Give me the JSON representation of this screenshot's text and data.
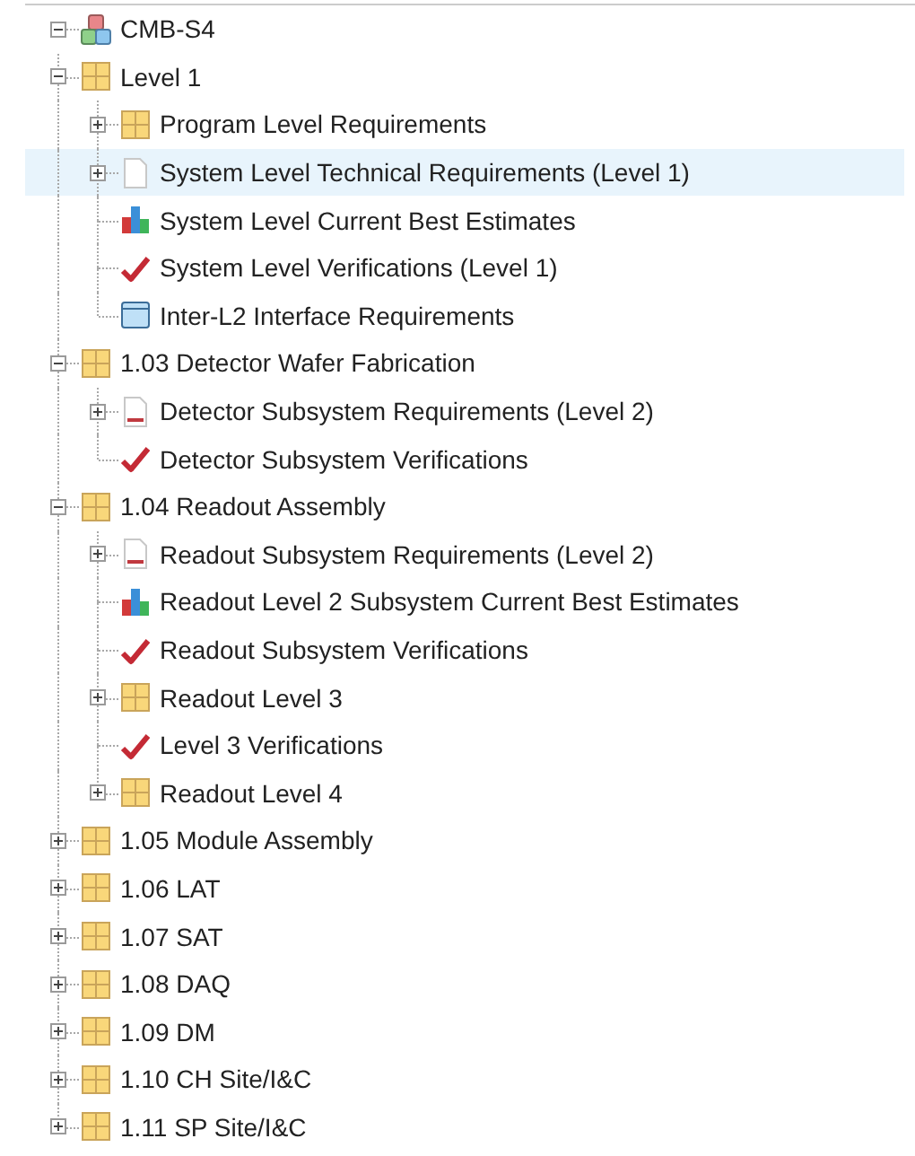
{
  "tree": [
    {
      "label": "CMB-S4",
      "kind": "package",
      "expanded": true,
      "selected": false,
      "children": [
        {
          "label": "Level 1",
          "kind": "folder",
          "expanded": true,
          "selected": false,
          "children": [
            {
              "label": "Program Level Requirements",
              "kind": "folder",
              "expanded": false,
              "selected": false
            },
            {
              "label": "System Level Technical Requirements (Level 1)",
              "kind": "document",
              "expanded": false,
              "selected": true
            },
            {
              "label": "System Level Current Best Estimates",
              "kind": "chart",
              "selected": false
            },
            {
              "label": "System Level Verifications (Level 1)",
              "kind": "check",
              "selected": false
            },
            {
              "label": "Inter-L2 Interface Requirements",
              "kind": "window",
              "selected": false
            }
          ]
        },
        {
          "label": "1.03 Detector Wafer Fabrication",
          "kind": "folder",
          "expanded": true,
          "selected": false,
          "children": [
            {
              "label": "Detector Subsystem Requirements (Level 2)",
              "kind": "report",
              "expanded": false,
              "selected": false
            },
            {
              "label": "Detector Subsystem Verifications",
              "kind": "check",
              "selected": false
            }
          ]
        },
        {
          "label": "1.04 Readout Assembly",
          "kind": "folder",
          "expanded": true,
          "selected": false,
          "children": [
            {
              "label": "Readout Subsystem Requirements (Level 2)",
              "kind": "report",
              "expanded": false,
              "selected": false
            },
            {
              "label": "Readout Level 2 Subsystem Current Best Estimates",
              "kind": "chart",
              "selected": false
            },
            {
              "label": "Readout Subsystem Verifications",
              "kind": "check",
              "selected": false
            },
            {
              "label": "Readout Level 3",
              "kind": "folder",
              "expanded": false,
              "selected": false
            },
            {
              "label": "Level 3 Verifications",
              "kind": "check",
              "selected": false
            },
            {
              "label": "Readout Level 4",
              "kind": "folder",
              "expanded": false,
              "selected": false
            }
          ]
        },
        {
          "label": "1.05 Module Assembly",
          "kind": "folder",
          "expanded": false,
          "selected": false
        },
        {
          "label": "1.06 LAT",
          "kind": "folder",
          "expanded": false,
          "selected": false
        },
        {
          "label": "1.07 SAT",
          "kind": "folder",
          "expanded": false,
          "selected": false
        },
        {
          "label": "1.08 DAQ",
          "kind": "folder",
          "expanded": false,
          "selected": false
        },
        {
          "label": "1.09 DM",
          "kind": "folder",
          "expanded": false,
          "selected": false
        },
        {
          "label": "1.10 CH Site/I&C",
          "kind": "folder",
          "expanded": false,
          "selected": false
        },
        {
          "label": "1.11 SP Site/I&C",
          "kind": "folder",
          "expanded": false,
          "selected": false
        }
      ]
    }
  ]
}
